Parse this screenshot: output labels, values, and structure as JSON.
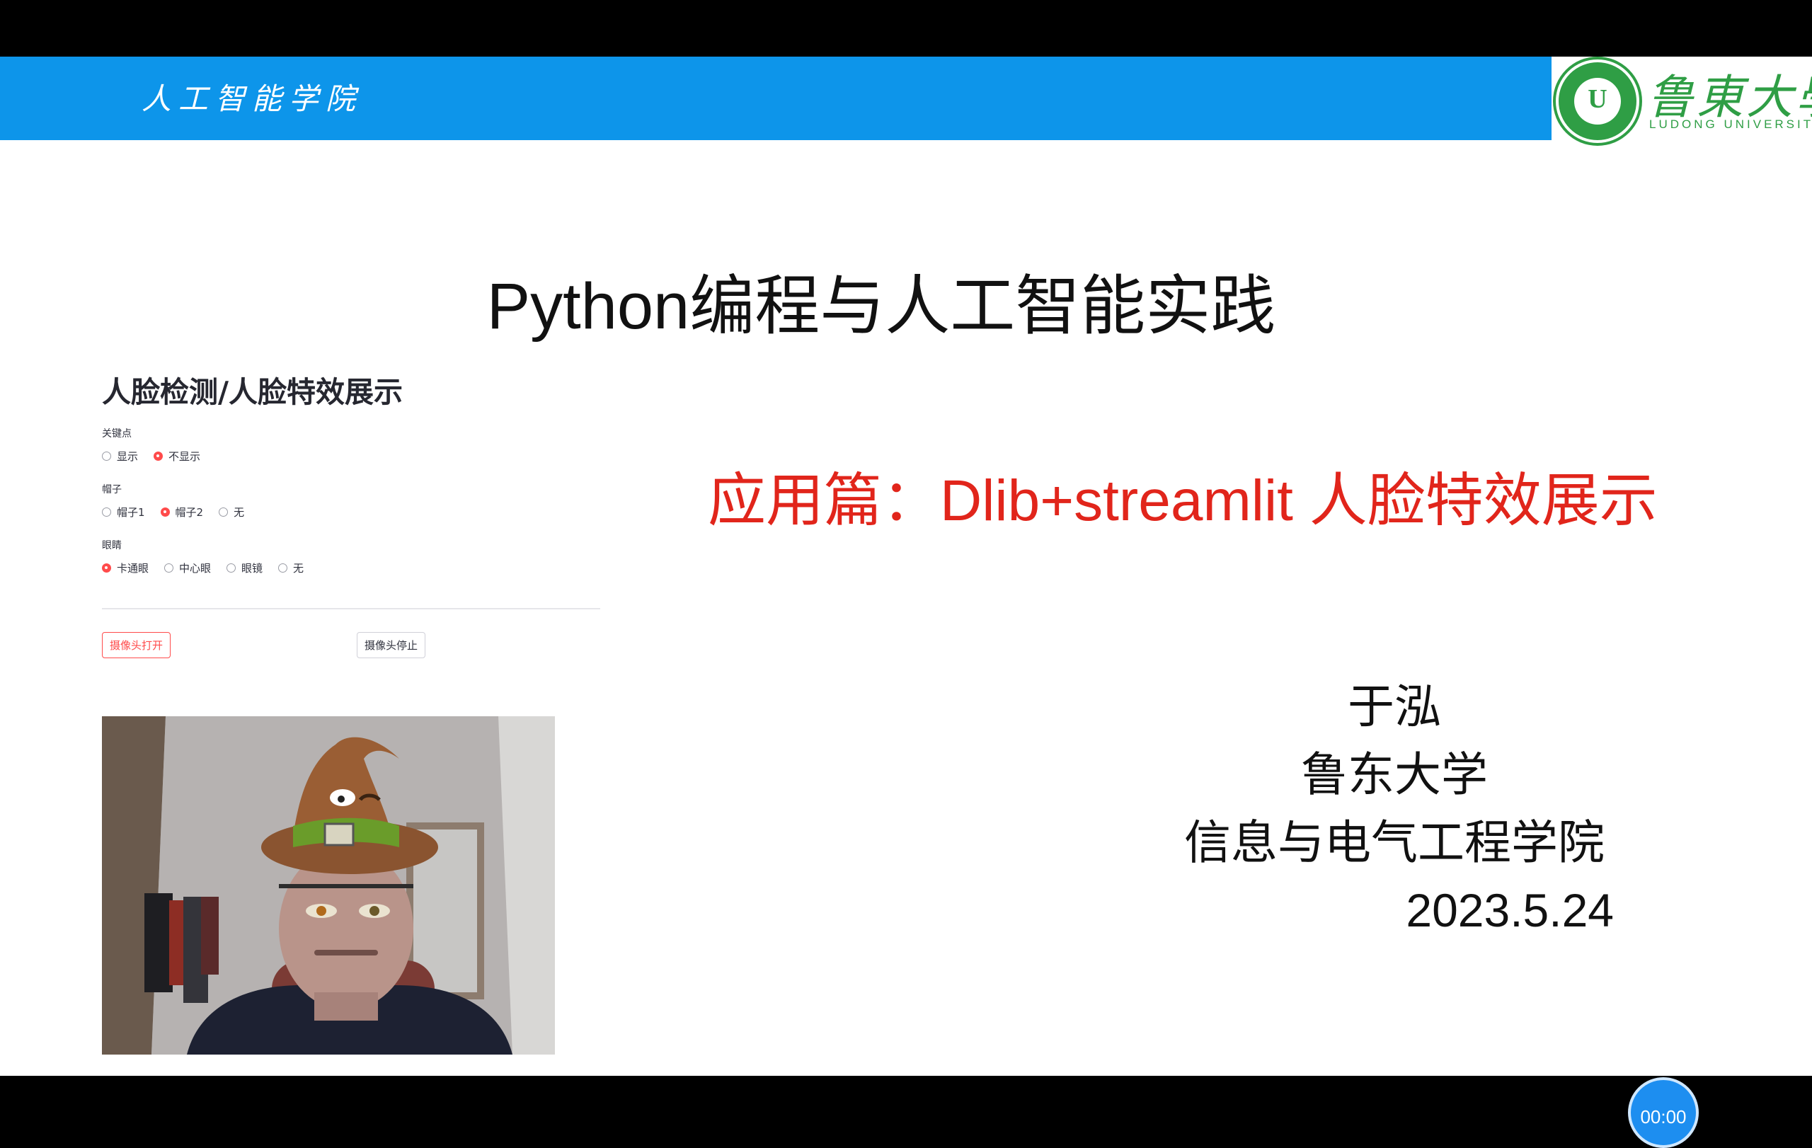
{
  "banner": {
    "title": "人工智能学院",
    "logo_mark": "U",
    "university_cn": "鲁東大學",
    "university_en": "LUDONG UNIVERSITY"
  },
  "slide": {
    "title": "Python编程与人工智能实践",
    "subtitle": "应用篇：Dlib+streamlit 人脸特效展示",
    "author": "于泓",
    "university": "鲁东大学",
    "school": "信息与电气工程学院",
    "date": "2023.5.24"
  },
  "app": {
    "title": "人脸检测/人脸特效展示",
    "groups": [
      {
        "label": "关键点",
        "options": [
          "显示",
          "不显示"
        ],
        "selected": 1
      },
      {
        "label": "帽子",
        "options": [
          "帽子1",
          "帽子2",
          "无"
        ],
        "selected": 1
      },
      {
        "label": "眼睛",
        "options": [
          "卡通眼",
          "中心眼",
          "眼镜",
          "无"
        ],
        "selected": 0
      }
    ],
    "open_button": "摄像头打开",
    "stop_button": "摄像头停止"
  },
  "player": {
    "timer": "00:00"
  },
  "colors": {
    "banner": "#0d95ea",
    "subtitle": "#e1251b",
    "accent": "#ff4b4b",
    "logo": "#2f9e45"
  }
}
